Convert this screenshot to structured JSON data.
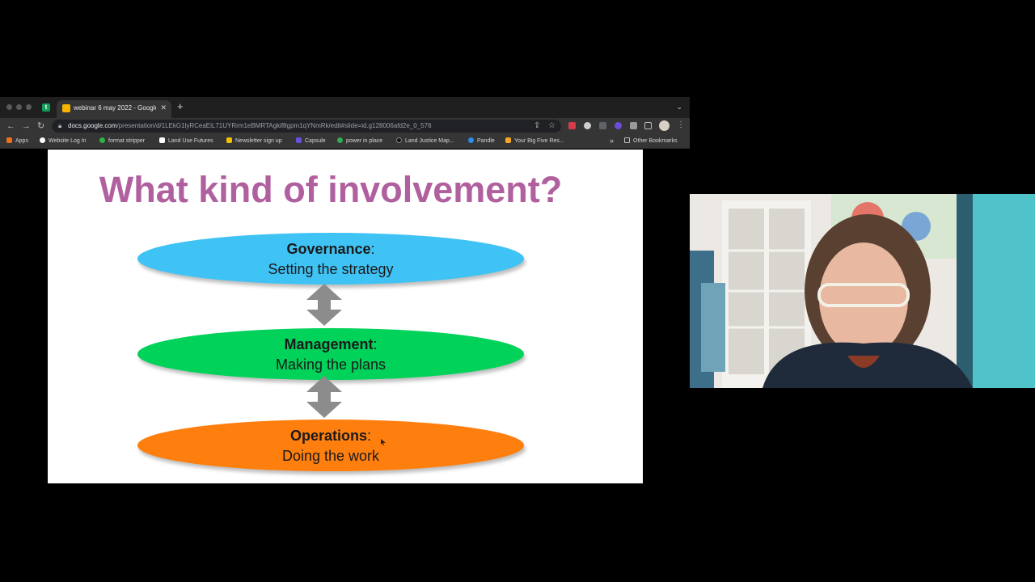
{
  "browser": {
    "tab_title": "webinar 6 may 2022 - Google",
    "pinned_tab_letter": "t",
    "url_host": "docs.google.com",
    "url_path": "/presentation/d/1LEkG1lyRCeaEiL71UYRrm1eBMRTAgkif8gpm1qYNmRk/edit#slide=id.g128006afd2e_0_576",
    "bookmarks": [
      "Apps",
      "Website Log In",
      "format stripper",
      "Land Use Futures",
      "Newsletter sign up",
      "Capsule",
      "power in place",
      "Land Justice Map...",
      "Pandle",
      "Your Big Five Res..."
    ],
    "other_bookmarks": "Other Bookmarks",
    "bookmarks_overflow": "»"
  },
  "slide": {
    "title": "What kind of involvement?",
    "items": [
      {
        "heading": "Governance",
        "colon": ":",
        "subtitle": "Setting the strategy",
        "color": "#3fc3f5"
      },
      {
        "heading": "Management",
        "colon": ":",
        "subtitle": "Making the plans",
        "color": "#00d25a"
      },
      {
        "heading": "Operations",
        "colon": ":",
        "subtitle": "Doing the work",
        "color": "#ff7f0e"
      }
    ],
    "title_color": "#b0609e",
    "arrow_color": "#8c8c8c"
  },
  "webcam": {
    "description": "presenter webcam"
  }
}
